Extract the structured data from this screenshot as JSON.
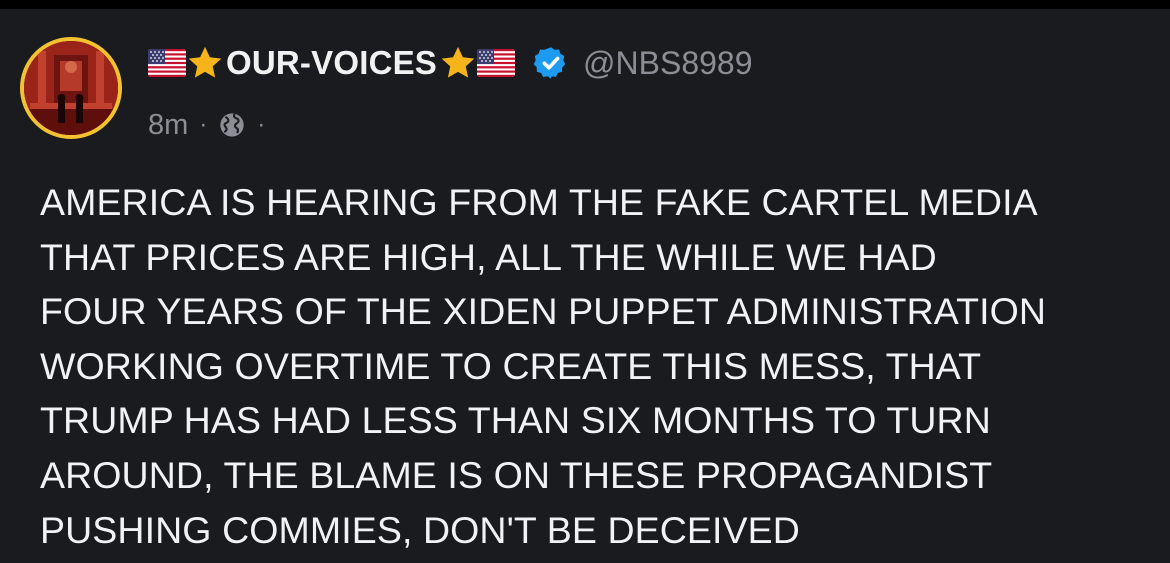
{
  "post": {
    "display_name": "OUR-VOICES",
    "handle": "@NBS8989",
    "timestamp": "8m",
    "separator": "·",
    "visibility_icon": "globe-icon",
    "verified": true,
    "name_decorations": [
      "us-flag-icon",
      "star-icon"
    ],
    "text_lines": [
      "AMERICA IS HEARING FROM THE FAKE CARTEL MEDIA",
      "THAT PRICES ARE HIGH, ALL THE WHILE WE HAD",
      "FOUR YEARS OF THE XIDEN PUPPET ADMINISTRATION",
      "WORKING OVERTIME TO CREATE THIS MESS, THAT",
      "TRUMP HAS HAD LESS THAN SIX MONTHS TO TURN",
      "AROUND, THE BLAME IS ON THESE PROPAGANDIST",
      "PUSHING COMMIES, DON'T BE DECEIVED"
    ]
  },
  "colors": {
    "background": "#1a1b1f",
    "text": "#f1f2f3",
    "muted": "#8b8e95",
    "avatar_ring": "#f2c230",
    "verified": "#1d9bf0",
    "star": "#f4b41a"
  }
}
